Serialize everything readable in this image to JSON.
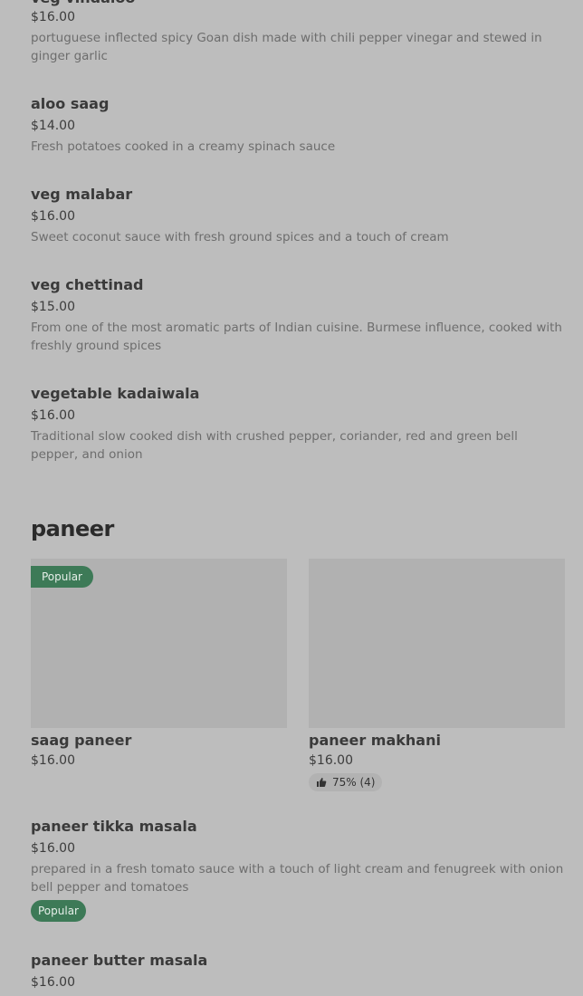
{
  "cut_item": {
    "name": "veg vindaloo",
    "price": "$16.00",
    "desc": "portuguese inflected spicy Goan dish made with chili pepper vinegar and stewed in ginger garlic"
  },
  "items_top": [
    {
      "name": "aloo saag",
      "price": "$14.00",
      "desc": "Fresh potatoes cooked in a creamy spinach sauce"
    },
    {
      "name": "veg malabar",
      "price": "$16.00",
      "desc": "Sweet coconut sauce with fresh ground spices and a touch of cream"
    },
    {
      "name": "veg chettinad",
      "price": "$15.00",
      "desc": "From one of the most aromatic parts of Indian cuisine. Burmese influence, cooked with freshly ground spices"
    },
    {
      "name": "vegetable kadaiwala",
      "price": "$16.00",
      "desc": "Traditional slow cooked dish with crushed pepper, coriander, red and green bell pepper, and onion"
    }
  ],
  "section": {
    "title": "paneer"
  },
  "cards": [
    {
      "badge": "Popular",
      "name": "saag paneer",
      "price": "$16.00"
    },
    {
      "name": "paneer makhani",
      "price": "$16.00",
      "rating": "75% (4)"
    }
  ],
  "items_bottom": [
    {
      "name": "paneer tikka masala",
      "price": "$16.00",
      "desc": "prepared in a fresh tomato sauce with a touch of light cream and fenugreek with onion bell pepper and tomatoes",
      "badge": "Popular"
    },
    {
      "name": "paneer butter masala",
      "price": "$16.00"
    }
  ],
  "icons": {
    "rating": "thumbs-up-icon"
  },
  "colors": {
    "background": "#bdbdbd",
    "badge": "#3d7a57",
    "image_placeholder": "#b1b1b1"
  }
}
